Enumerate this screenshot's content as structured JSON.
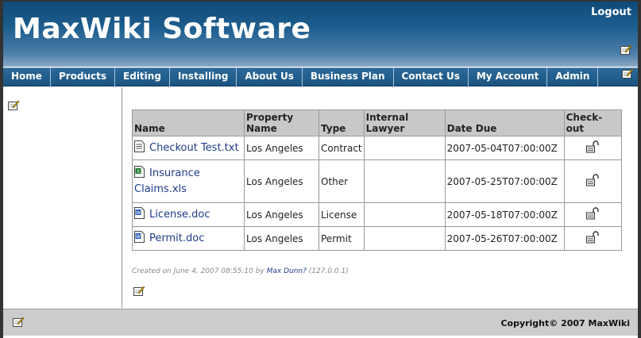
{
  "header": {
    "title": "MaxWiki Software",
    "logout_label": "Logout"
  },
  "nav": {
    "items": [
      "Home",
      "Products",
      "Editing",
      "Installing",
      "About Us",
      "Business Plan",
      "Contact Us",
      "My Account",
      "Admin"
    ]
  },
  "table": {
    "headers": {
      "name": "Name",
      "property_name": "Property Name",
      "type": "Type",
      "internal_lawyer": "Internal Lawyer",
      "date_due": "Date Due",
      "checkout": "Check-out"
    },
    "rows": [
      {
        "name": "Checkout Test.txt",
        "icon": "text-file-icon",
        "property_name": "Los Angeles",
        "type": "Contract",
        "internal_lawyer": "",
        "date_due": "2007-05-04T07:00:00Z"
      },
      {
        "name": "Insurance Claims.xls",
        "icon": "excel-file-icon",
        "property_name": "Los Angeles",
        "type": "Other",
        "internal_lawyer": "",
        "date_due": "2007-05-25T07:00:00Z"
      },
      {
        "name": "License.doc",
        "icon": "word-file-icon",
        "property_name": "Los Angeles",
        "type": "License",
        "internal_lawyer": "",
        "date_due": "2007-05-18T07:00:00Z"
      },
      {
        "name": "Permit.doc",
        "icon": "word-file-icon",
        "property_name": "Los Angeles",
        "type": "Permit",
        "internal_lawyer": "",
        "date_due": "2007-05-26T07:00:00Z"
      }
    ]
  },
  "meta": {
    "created_prefix": "Created on June 4, 2007 08:55:10 by ",
    "author": "Max Dunn?",
    "ip": " (127.0.0.1)"
  },
  "footer": {
    "copyright": "Copyright© 2007 MaxWiki"
  },
  "colors": {
    "header_top": "#0f4a78",
    "nav_bg": "#1b5380",
    "link": "#1e3a8a",
    "table_header_bg": "#c8c8c8",
    "footer_bg": "#cccccc"
  }
}
